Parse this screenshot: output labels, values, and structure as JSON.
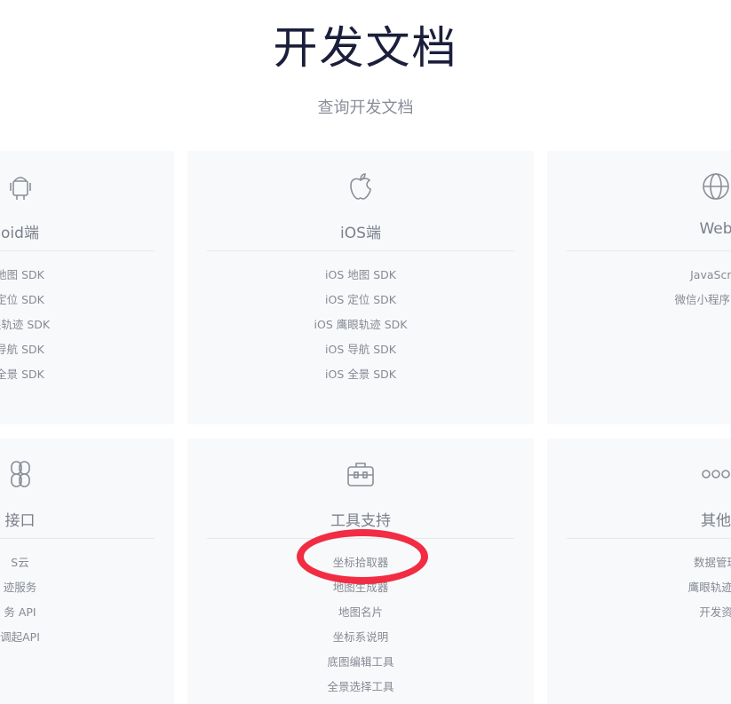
{
  "header": {
    "title": "开发文档",
    "subtitle": "查询开发文档"
  },
  "cards": {
    "android": {
      "title": "oid端",
      "icon": "android-icon",
      "items": [
        "地图 SDK",
        "定位 SDK",
        "眼轨迹 SDK",
        "导航 SDK",
        "全景 SDK"
      ]
    },
    "ios": {
      "title": "iOS端",
      "icon": "apple-icon",
      "items": [
        "iOS 地图 SDK",
        "iOS 定位 SDK",
        "iOS 鹰眼轨迹 SDK",
        "iOS 导航 SDK",
        "iOS 全景 SDK"
      ]
    },
    "web": {
      "title": "Web",
      "icon": "globe-icon",
      "items": [
        "JavaScrip",
        "微信小程序 Java"
      ]
    },
    "service": {
      "title": "接口",
      "icon": "link-icon",
      "items": [
        "S云",
        "迹服务",
        "务 API",
        "调起API"
      ]
    },
    "tools": {
      "title": "工具支持",
      "icon": "toolbox-icon",
      "items": [
        "坐标拾取器",
        "地图生成器",
        "地图名片",
        "坐标系说明",
        "底图编辑工具",
        "全景选择工具"
      ]
    },
    "other": {
      "title": "其他",
      "icon": "more-dots-icon",
      "items": [
        "数据管理",
        "鹰眼轨迹管",
        "开发资"
      ]
    }
  },
  "colors": {
    "title": "#1b1f3b",
    "subtitle": "#8b8e99",
    "card_bg": "#f8f9fb",
    "card_text": "#868a94",
    "annotation": "#f12c43"
  }
}
